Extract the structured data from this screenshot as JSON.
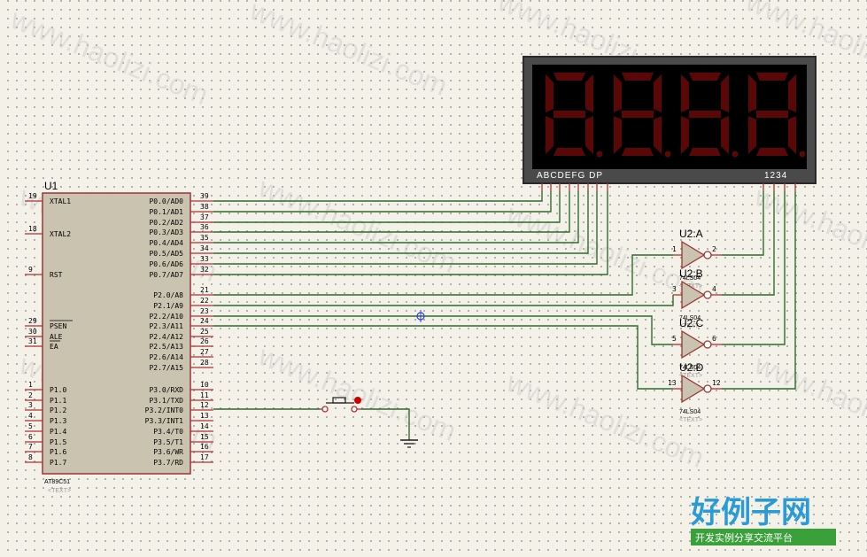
{
  "mcu": {
    "ref": "U1",
    "part": "AT89C51",
    "text_placeholder": "<TEXT>",
    "left_pins": [
      {
        "num": "19",
        "name": "XTAL1"
      },
      {
        "num": "18",
        "name": "XTAL2"
      },
      {
        "num": "9",
        "name": "RST"
      },
      {
        "num": "29",
        "name": "PSEN"
      },
      {
        "num": "30",
        "name": "ALE"
      },
      {
        "num": "31",
        "name": "EA"
      },
      {
        "num": "1",
        "name": "P1.0"
      },
      {
        "num": "2",
        "name": "P1.1"
      },
      {
        "num": "3",
        "name": "P1.2"
      },
      {
        "num": "4",
        "name": "P1.3"
      },
      {
        "num": "5",
        "name": "P1.4"
      },
      {
        "num": "6",
        "name": "P1.5"
      },
      {
        "num": "7",
        "name": "P1.6"
      },
      {
        "num": "8",
        "name": "P1.7"
      }
    ],
    "right_pins": [
      {
        "num": "39",
        "name": "P0.0/AD0"
      },
      {
        "num": "38",
        "name": "P0.1/AD1"
      },
      {
        "num": "37",
        "name": "P0.2/AD2"
      },
      {
        "num": "36",
        "name": "P0.3/AD3"
      },
      {
        "num": "35",
        "name": "P0.4/AD4"
      },
      {
        "num": "34",
        "name": "P0.5/AD5"
      },
      {
        "num": "33",
        "name": "P0.6/AD6"
      },
      {
        "num": "32",
        "name": "P0.7/AD7"
      },
      {
        "num": "21",
        "name": "P2.0/A8"
      },
      {
        "num": "22",
        "name": "P2.1/A9"
      },
      {
        "num": "23",
        "name": "P2.2/A10"
      },
      {
        "num": "24",
        "name": "P2.3/A11"
      },
      {
        "num": "25",
        "name": "P2.4/A12"
      },
      {
        "num": "26",
        "name": "P2.5/A13"
      },
      {
        "num": "27",
        "name": "P2.6/A14"
      },
      {
        "num": "28",
        "name": "P2.7/A15"
      },
      {
        "num": "10",
        "name": "P3.0/RXD"
      },
      {
        "num": "11",
        "name": "P3.1/TXD"
      },
      {
        "num": "12",
        "name": "P3.2/INT0"
      },
      {
        "num": "13",
        "name": "P3.3/INT1"
      },
      {
        "num": "14",
        "name": "P3.4/T0"
      },
      {
        "num": "15",
        "name": "P3.5/T1"
      },
      {
        "num": "16",
        "name": "P3.6/WR"
      },
      {
        "num": "17",
        "name": "P3.7/RD"
      }
    ]
  },
  "display": {
    "digits": "8888",
    "segment_label": "ABCDEFG  DP",
    "digit_label": "1234"
  },
  "gates": [
    {
      "ref": "U2:A",
      "in": "1",
      "out": "2",
      "part": "74LS04",
      "text": "<TEXT>"
    },
    {
      "ref": "U2:B",
      "in": "3",
      "out": "4",
      "part": "74LS04",
      "text": "<TEXT>"
    },
    {
      "ref": "U2:C",
      "in": "5",
      "out": "6",
      "part": "74LS04",
      "text": "<TEXT>"
    },
    {
      "ref": "U2:D",
      "in": "13",
      "out": "12",
      "part": "74LS04",
      "text": "<TEXT>"
    }
  ],
  "watermark": {
    "text": "www.haolizi.com",
    "logo": "好例子网",
    "slogan": "开发实例分享交流平台"
  }
}
